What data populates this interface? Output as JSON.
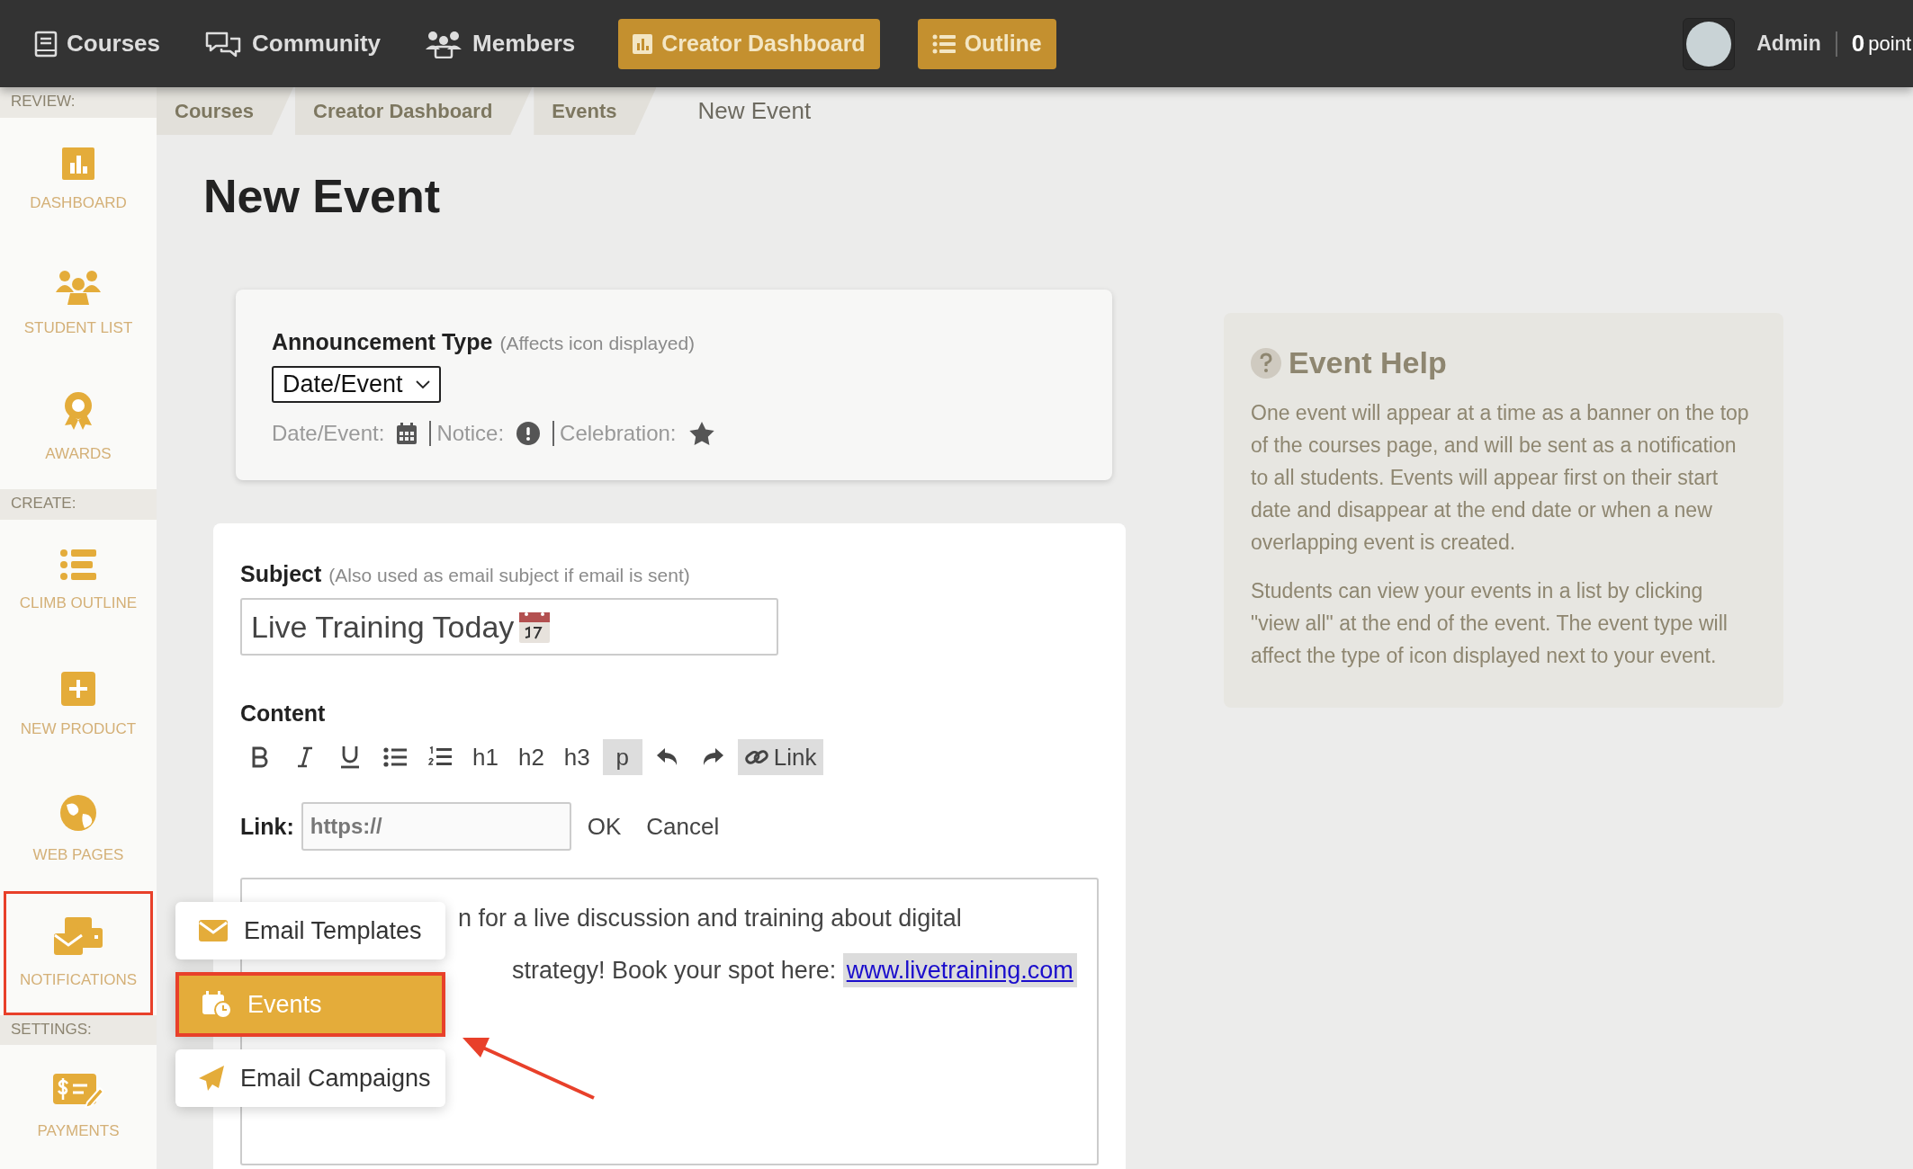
{
  "top_nav": {
    "links": [
      {
        "label": "Courses"
      },
      {
        "label": "Community"
      },
      {
        "label": "Members"
      }
    ],
    "buttons": [
      {
        "label": "Creator Dashboard"
      },
      {
        "label": "Outline"
      }
    ],
    "user": {
      "name": "Admin",
      "points_value": "0",
      "points_label": "point"
    }
  },
  "sidebar": {
    "sections": [
      {
        "label": "REVIEW:",
        "items": [
          {
            "label": "DASHBOARD",
            "highlighted": false
          },
          {
            "label": "STUDENT LIST",
            "highlighted": false
          },
          {
            "label": "AWARDS",
            "highlighted": false
          }
        ]
      },
      {
        "label": "CREATE:",
        "items": [
          {
            "label": "CLIMB OUTLINE",
            "highlighted": false
          },
          {
            "label": "NEW PRODUCT",
            "highlighted": false
          },
          {
            "label": "WEB PAGES",
            "highlighted": false
          },
          {
            "label": "NOTIFICATIONS",
            "highlighted": true
          }
        ]
      },
      {
        "label": "SETTINGS:",
        "items": [
          {
            "label": "PAYMENTS",
            "highlighted": false
          }
        ]
      }
    ]
  },
  "breadcrumbs": [
    {
      "label": "Courses",
      "current": false
    },
    {
      "label": "Creator Dashboard",
      "current": false
    },
    {
      "label": "Events",
      "current": false
    },
    {
      "label": "New Event",
      "current": true
    }
  ],
  "page_title": "New Event",
  "type_card": {
    "label": "Announcement Type",
    "hint": "(Affects icon displayed)",
    "select_value": "Date/Event",
    "legend": [
      {
        "label": "Date/Event:"
      },
      {
        "label": "Notice:"
      },
      {
        "label": "Celebration:"
      }
    ]
  },
  "form": {
    "subject_label": "Subject",
    "subject_hint": "(Also used as email subject if email is sent)",
    "subject_value": "Live Training Today",
    "content_label": "Content",
    "toolbar": [
      {
        "kind": "bold",
        "selected": false
      },
      {
        "kind": "italic",
        "selected": false
      },
      {
        "kind": "underline",
        "selected": false
      },
      {
        "kind": "bullets",
        "selected": false
      },
      {
        "kind": "numbers",
        "selected": false
      },
      {
        "kind": "text",
        "label": "h1",
        "selected": false
      },
      {
        "kind": "text",
        "label": "h2",
        "selected": false
      },
      {
        "kind": "text",
        "label": "h3",
        "selected": false
      },
      {
        "kind": "text",
        "label": "p",
        "selected": true
      },
      {
        "kind": "undo",
        "selected": false
      },
      {
        "kind": "redo",
        "selected": false
      },
      {
        "kind": "link",
        "label": "Link",
        "selected": true
      }
    ],
    "link_label": "Link:",
    "link_placeholder": "https://",
    "ok": "OK",
    "cancel": "Cancel",
    "editor_lines": [
      "n for a live discussion and training about digital",
      "strategy! Book your spot here:"
    ],
    "editor_link": "www.livetraining.com"
  },
  "popup_menu": [
    {
      "label": "Email Templates",
      "selected": false
    },
    {
      "label": "Events",
      "selected": true
    },
    {
      "label": "Email Campaigns",
      "selected": false
    }
  ],
  "help": {
    "title": "Event Help",
    "paragraphs": [
      "One event will appear at a time as a banner on the top of the courses page, and will be sent as a notification to all students. Events will appear first on their start date and disappear at the end date or when a new overlapping event is created.",
      "Students can view your events in a list by clicking \"view all\" at the end of the event. The event type will affect the type of icon displayed next to your event."
    ]
  }
}
